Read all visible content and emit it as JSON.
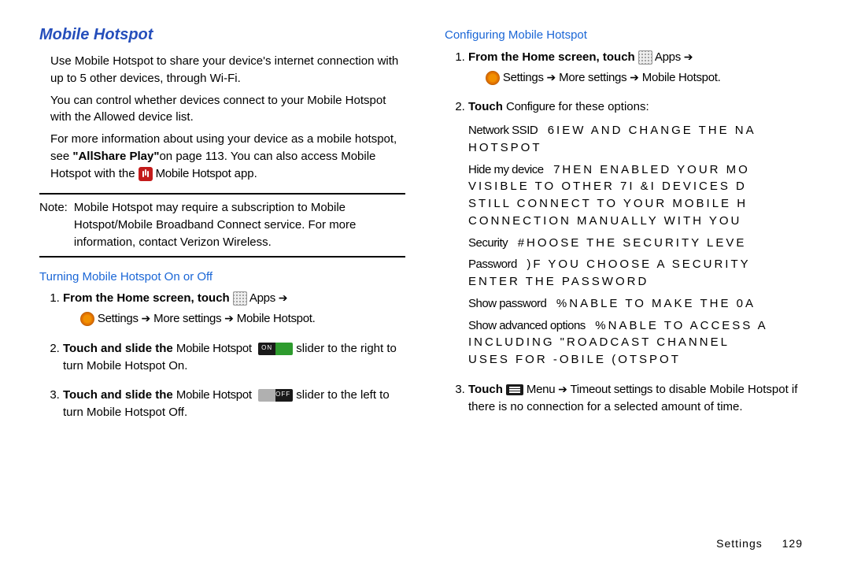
{
  "left": {
    "title": "Mobile Hotspot",
    "p1": "Use Mobile Hotspot to share your device's internet connection with up to 5 other devices, through Wi-Fi.",
    "p2": "You can control whether devices connect to your Mobile Hotspot with the Allowed device list.",
    "p3a": "For more information about using your device as a mobile hotspot, see ",
    "p3b": "\"AllShare Play\"",
    "p3c": "on page 113. You can also access Mobile Hotspot with the ",
    "p3d": " Mobile Hotspot",
    "p3e": "  app.",
    "noteLabel": "Note:",
    "noteText": "Mobile Hotspot may require a subscription to Mobile Hotspot/Mobile Broadband Connect service. For more information, contact Verizon Wireless.",
    "sub1": "Turning Mobile Hotspot On or Off",
    "s1_1a": "From the Home screen, touch ",
    "s1_1b": " Apps ",
    "s1_1c": " Settings ",
    "s1_1d": " More settings ",
    "s1_1e": " Mobile Hotspot",
    "s1_2a": "Touch and slide the ",
    "s1_2b": "Mobile Hotspot",
    "s1_2c": "  slider to the right to turn Mobile Hotspot On.",
    "s1_3a": "Touch and slide the ",
    "s1_3b": "Mobile Hotspot",
    "s1_3c": "  slider to the left to turn Mobile Hotspot Off."
  },
  "right": {
    "sub2": "Configuring Mobile Hotspot",
    "r1_1a": "From the Home screen, touch ",
    "r1_1b": " Apps ",
    "r1_1c": " Settings ",
    "r1_1d": " More settings ",
    "r1_1e": " Mobile Hotspot",
    "r2a": "Touch ",
    "r2b": "Configure",
    "r2c": "  for these options:",
    "opt1a": "Network SSID",
    "opt1b": "6IEW AND CHANGE THE NA",
    "opt1c": "HOTSPOT",
    "opt2a": "Hide my device",
    "opt2b": "7HEN ENABLED  YOUR MO",
    "opt2c": "VISIBLE TO OTHER 7I &I DEVICES D",
    "opt2d": "STILL CONNECT TO YOUR MOBILE H",
    "opt2e": "CONNECTION MANUALLY WITH YOU",
    "opt3a": "Security",
    "opt3b": "#HOOSE THE SECURITY LEVE",
    "opt4a": "Password",
    "opt4b": ")F YOU CHOOSE A SECURITY",
    "opt4c": "ENTER THE PASSWORD",
    "opt5a": "Show password",
    "opt5b": "%NABLE TO MAKE THE 0A",
    "opt6a": "Show advanced options",
    "opt6b": "%NABLE TO ACCESS A",
    "opt6c": "INCLUDING \"ROADCAST CHANNEL",
    "opt6d": "USES FOR -OBILE (OTSPOT",
    "r3a": "Touch ",
    "r3b": " Menu ",
    "r3c": " Timeout settings",
    "r3d": "  to disable Mobile Hotspot if there is no connection for a selected amount of time."
  },
  "footer": {
    "name": "Settings",
    "num": "129"
  },
  "arrow": "➔",
  "dot": "."
}
